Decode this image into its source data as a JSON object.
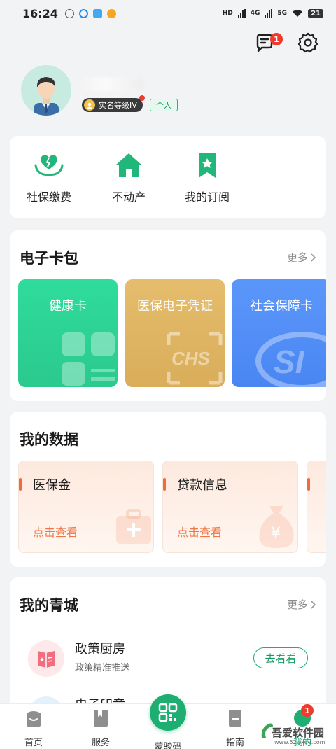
{
  "status_bar": {
    "time": "16:24",
    "network_labels": [
      "HD",
      "4G",
      "5G"
    ],
    "battery": "21"
  },
  "header": {
    "message_badge": "1"
  },
  "profile": {
    "level_label": "实名等级IV",
    "type_tag": "个人"
  },
  "quick_actions": [
    {
      "label": "社保缴费",
      "icon": "heart-hands-icon"
    },
    {
      "label": "不动产",
      "icon": "house-icon"
    },
    {
      "label": "我的订阅",
      "icon": "bookmark-star-icon"
    }
  ],
  "wallet": {
    "title": "电子卡包",
    "more": "更多",
    "cards": [
      {
        "label": "健康卡",
        "color": "#2ed497"
      },
      {
        "label": "医保电子凭证",
        "color": "#ddb15d"
      },
      {
        "label": "社会保障卡",
        "color": "#4d8ef8"
      }
    ]
  },
  "my_data": {
    "title": "我的数据",
    "items": [
      {
        "title": "医保金",
        "action": "点击查看"
      },
      {
        "title": "贷款信息",
        "action": "点击查看"
      }
    ]
  },
  "my_city": {
    "title": "我的青城",
    "more": "更多",
    "items": [
      {
        "title": "政策厨房",
        "subtitle": "政策精准推送",
        "button": "去看看"
      },
      {
        "title": "电子印章",
        "subtitle": "",
        "button": ""
      }
    ]
  },
  "tabbar": {
    "items": [
      "首页",
      "服务",
      "蒙骏码",
      "指南",
      "我的"
    ],
    "badge": "1"
  },
  "watermark": {
    "text": "吾爱软件园",
    "url": "www.52zixue.com"
  },
  "colors": {
    "brand_green": "#1fae72",
    "badge_red": "#ee3b2d",
    "data_orange": "#ef7545"
  }
}
